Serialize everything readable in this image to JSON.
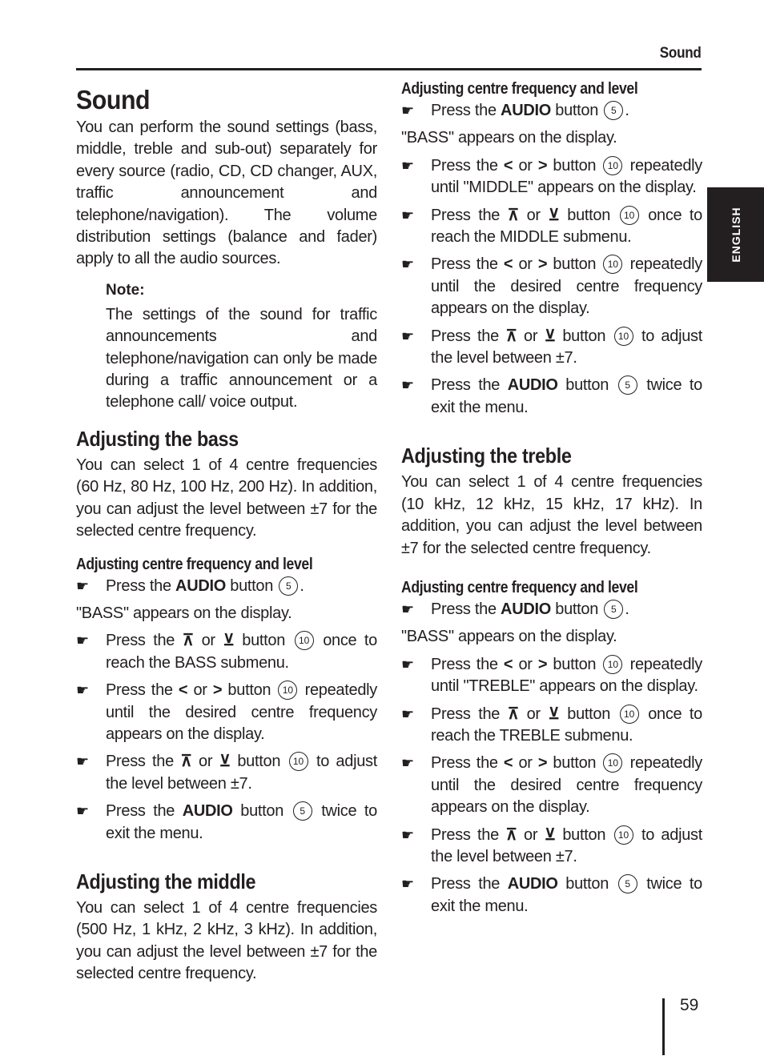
{
  "running_head": "Sound",
  "language_tab": "ENGLISH",
  "page_number": "59",
  "title": "Sound",
  "intro": "You can perform the sound settings (bass, middle, treble and sub-out) separately for every source (radio, CD, CD changer, AUX, traffic announcement and telephone/navigation). The volume distribution settings (balance and fader) apply to all the audio sources.",
  "note": {
    "label": "Note:",
    "text": "The settings of the sound for traffic announcements and telephone/navigation can only be made during a traffic announcement or a telephone call/ voice output."
  },
  "icons": {
    "bullet": "pointing-hand-icon",
    "left": "<",
    "right": ">",
    "up": "⊼",
    "down": "⊻",
    "hand": "☛"
  },
  "sections": {
    "bass": {
      "heading": "Adjusting the bass",
      "body": "You can select 1 of 4 centre frequencies (60 Hz, 80 Hz, 100 Hz, 200 Hz). In addition, you can adjust the level between ±7 for the selected centre frequency.",
      "subheading": "Adjusting centre frequency and level",
      "steps": [
        {
          "pre": "Press the ",
          "bold": "AUDIO",
          "post": " button",
          "num": "5",
          "end": "."
        },
        {
          "plain": "\"BASS\" appears on the display."
        },
        {
          "pre": "Press the ",
          "keys": "up-or-down",
          "post": " button",
          "num": "10",
          "end": " once to reach the BASS submenu."
        },
        {
          "pre": "Press the ",
          "keys": "left-or-right",
          "post": " button",
          "num": "10",
          "end": " repeatedly until the desired centre frequency appears on the display."
        },
        {
          "pre": "Press the ",
          "keys": "up-or-down",
          "post": " button",
          "num": "10",
          "end": " to adjust the level between ±7."
        },
        {
          "pre": "Press the ",
          "bold": "AUDIO",
          "post": " button",
          "num": "5",
          "end": " twice to exit the menu."
        }
      ]
    },
    "middle": {
      "heading": "Adjusting the middle",
      "body": "You can select 1 of 4 centre frequencies (500 Hz, 1 kHz, 2 kHz, 3 kHz). In addition, you can adjust the level between ±7 for the selected centre frequency.",
      "subheading": "Adjusting centre frequency and level",
      "steps": [
        {
          "pre": "Press the ",
          "bold": "AUDIO",
          "post": " button",
          "num": "5",
          "end": "."
        },
        {
          "plain": "\"BASS\" appears on the display."
        },
        {
          "pre": "Press the ",
          "keys": "left-or-right",
          "post": " button",
          "num": "10",
          "end": " repeatedly until \"MIDDLE\" appears on the display."
        },
        {
          "pre": "Press the ",
          "keys": "up-or-down",
          "post": " button",
          "num": "10",
          "end": " once to reach the MIDDLE submenu."
        },
        {
          "pre": "Press the ",
          "keys": "left-or-right",
          "post": " button",
          "num": "10",
          "end": " repeatedly until the desired centre frequency appears on the display."
        },
        {
          "pre": "Press the ",
          "keys": "up-or-down",
          "post": " button",
          "num": "10",
          "end": " to adjust the level between ±7."
        },
        {
          "pre": "Press the ",
          "bold": "AUDIO",
          "post": " button",
          "num": "5",
          "end": " twice to exit the menu."
        }
      ]
    },
    "treble": {
      "heading": "Adjusting the treble",
      "body": "You can select 1 of 4 centre frequencies (10 kHz, 12 kHz, 15 kHz, 17 kHz). In addition, you can adjust the level between ±7 for the selected centre frequency.",
      "subheading": "Adjusting centre frequency and level",
      "steps": [
        {
          "pre": "Press the ",
          "bold": "AUDIO",
          "post": " button",
          "num": "5",
          "end": "."
        },
        {
          "plain": "\"BASS\" appears on the display."
        },
        {
          "pre": "Press the ",
          "keys": "left-or-right",
          "post": " button",
          "num": "10",
          "end": " repeatedly until \"TREBLE\" appears on the display."
        },
        {
          "pre": "Press the ",
          "keys": "up-or-down",
          "post": " button",
          "num": "10",
          "end": " once to reach the TREBLE submenu."
        },
        {
          "pre": "Press the ",
          "keys": "left-or-right",
          "post": " button",
          "num": "10",
          "end": " repeatedly until the desired centre frequency appears on the display."
        },
        {
          "pre": "Press the ",
          "keys": "up-or-down",
          "post": " button",
          "num": "10",
          "end": " to adjust the level between ±7."
        },
        {
          "pre": "Press the ",
          "bold": "AUDIO",
          "post": " button",
          "num": "5",
          "end": " twice to exit the menu."
        }
      ]
    }
  }
}
